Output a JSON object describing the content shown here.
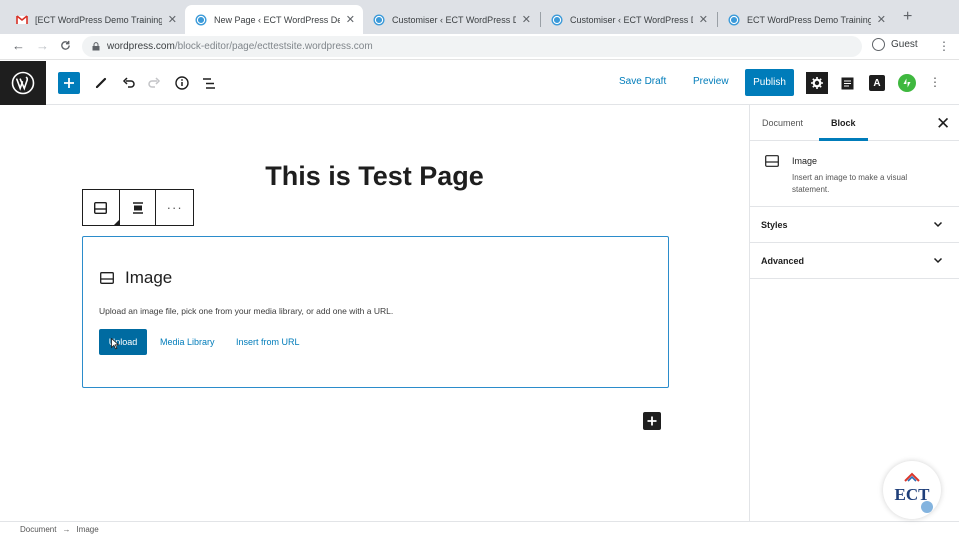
{
  "browser": {
    "tabs": [
      {
        "title": "[ECT WordPress Demo Training",
        "favicon": "gmail-icon",
        "active": false
      },
      {
        "title": "New Page ‹ ECT WordPress De",
        "favicon": "wordpress-icon",
        "active": true
      },
      {
        "title": "Customiser ‹ ECT WordPress D",
        "favicon": "wordpress-icon",
        "active": false
      },
      {
        "title": "Customiser ‹ ECT WordPress D",
        "favicon": "wordpress-icon",
        "active": false
      },
      {
        "title": "ECT WordPress Demo Training",
        "favicon": "wordpress-icon",
        "active": false
      }
    ],
    "new_tab": "+",
    "url_domain": "wordpress.com",
    "url_path": "/block-editor/page/ecttestsite.wordpress.com",
    "profile_label": "Guest"
  },
  "toolbar": {
    "save_draft": "Save Draft",
    "preview": "Preview",
    "publish": "Publish",
    "amp_label": "A"
  },
  "content": {
    "page_title": "This is Test Page",
    "image_block": {
      "heading": "Image",
      "instructions": "Upload an image file, pick one from your media library, or add one with a URL.",
      "upload": "Upload",
      "media_library": "Media Library",
      "insert_url": "Insert from URL"
    }
  },
  "sidebar": {
    "tab_document": "Document",
    "tab_block": "Block",
    "block_name": "Image",
    "block_desc": "Insert an image to make a visual statement.",
    "panels": [
      "Styles",
      "Advanced"
    ]
  },
  "footer": {
    "breadcrumb": [
      "Document",
      "→",
      "Image"
    ]
  },
  "watermark": "ECT",
  "colors": {
    "accent": "#007cba",
    "dark": "#1e1e1e",
    "tabbar": "#dee1e6"
  }
}
